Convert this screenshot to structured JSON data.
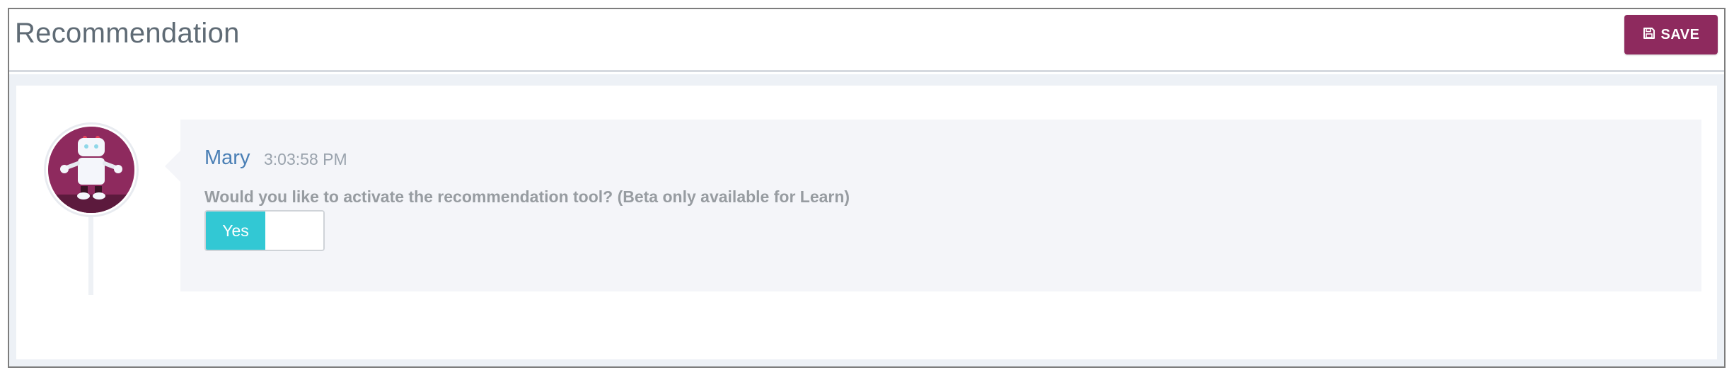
{
  "header": {
    "title": "Recommendation",
    "save_label": "SAVE",
    "save_icon": "floppy-disk-icon"
  },
  "colors": {
    "brand": "#8e2a5e",
    "toggle_on": "#32c8d4",
    "sender_name": "#4a7fb5"
  },
  "message": {
    "avatar_icon": "robot-icon",
    "sender": "Mary",
    "time": "3:03:58 PM",
    "question": "Would you like to activate the recommendation tool? (Beta only available for Learn)",
    "toggle": {
      "label": "Yes",
      "state": "on"
    }
  }
}
